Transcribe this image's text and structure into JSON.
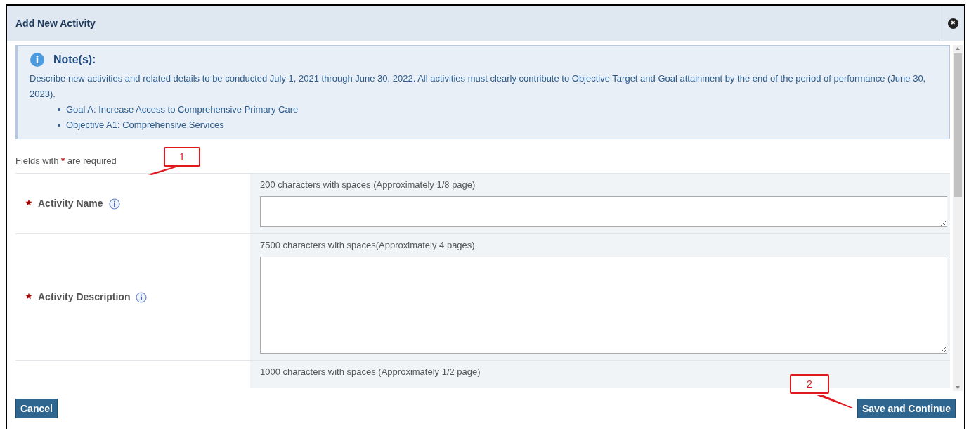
{
  "dialog": {
    "title": "Add New Activity",
    "close": "✖"
  },
  "note": {
    "title": "Note(s):",
    "text": "Describe new activities and related details to be conducted July 1, 2021 through June 30, 2022. All activities must clearly contribute to Objective Target and Goal attainment by the end of the period of performance (June 30, 2023).",
    "bullets": [
      "Goal A: Increase Access to Comprehensive Primary Care",
      "Objective A1: Comprehensive Services"
    ]
  },
  "required_hint": {
    "before": "Fields with",
    "star": "*",
    "after": "are required"
  },
  "fields": [
    {
      "kind": "single",
      "label": "Activity Name",
      "required": true,
      "hint": "200 characters with spaces (Approximately 1/8 page)"
    },
    {
      "kind": "multi",
      "label": "Activity Description",
      "required": true,
      "hint": "7500 characters with spaces(Approximately 4 pages)"
    },
    {
      "kind": "partial",
      "hint": "1000 characters with spaces (Approximately 1/2 page)"
    }
  ],
  "buttons": [
    {
      "label": "Cancel"
    },
    {
      "label": "Save and Continue"
    }
  ],
  "annotations": [
    {
      "label": "1"
    },
    {
      "label": "2"
    }
  ]
}
